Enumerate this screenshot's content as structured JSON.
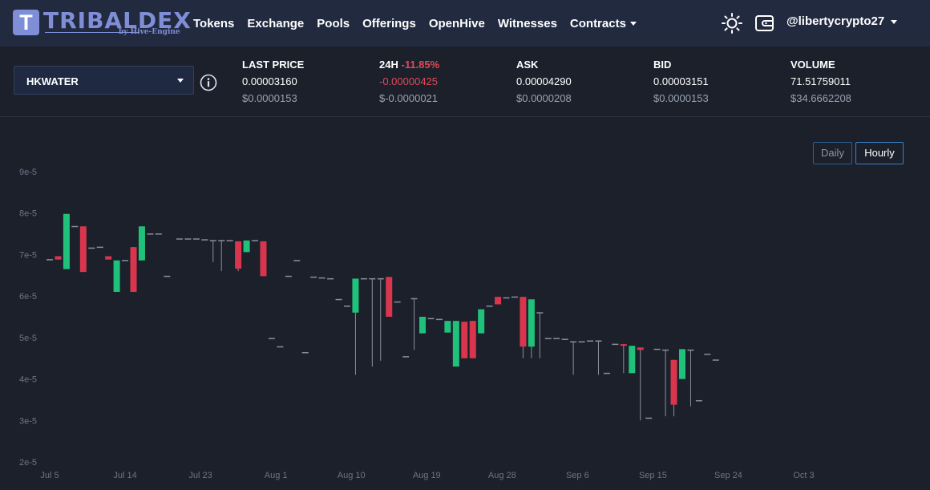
{
  "nav": {
    "logo_letter": "T",
    "logo_text": "TRIBALDEX",
    "logo_sub": "by Hive-Engine",
    "links": [
      {
        "label": "Tokens"
      },
      {
        "label": "Exchange"
      },
      {
        "label": "Pools"
      },
      {
        "label": "Offerings"
      },
      {
        "label": "OpenHive"
      },
      {
        "label": "Witnesses"
      },
      {
        "label": "Contracts",
        "dropdown": true
      }
    ],
    "theme_icon": "sun-icon",
    "wallet_icon": "wallet-icon",
    "username": "@libertycrypto27"
  },
  "token": {
    "selected": "HKWATER",
    "info_icon": "info-icon",
    "stats": {
      "last_price": {
        "title": "LAST PRICE",
        "value": "0.00003160",
        "usd": "$0.0000153"
      },
      "change_24h": {
        "title": "24H",
        "change_pct": "-11.85%",
        "value": "-0.00000425",
        "usd": "$-0.0000021"
      },
      "ask": {
        "title": "ASK",
        "value": "0.00004290",
        "usd": "$0.0000208"
      },
      "bid": {
        "title": "BID",
        "value": "0.00003151",
        "usd": "$0.0000153"
      },
      "volume": {
        "title": "VOLUME",
        "value": "71.51759011",
        "usd": "$34.6662208"
      }
    }
  },
  "chart_controls": {
    "daily": "Daily",
    "hourly": "Hourly",
    "active": "Hourly"
  },
  "colors": {
    "up": "#1fc17b",
    "down": "#d9364e",
    "flat": "#8a8f9c",
    "accent": "#7f8ed6",
    "negative_text": "#e04b58"
  },
  "chart_data": {
    "type": "candlestick",
    "y_ticks": [
      "9e-5",
      "8e-5",
      "7e-5",
      "6e-5",
      "5e-5",
      "4e-5",
      "3e-5",
      "2e-5"
    ],
    "ylim": [
      2e-05,
      9e-05
    ],
    "x_ticks": [
      "Jul 5",
      "Jul 14",
      "Jul 23",
      "Aug 1",
      "Aug 10",
      "Aug 19",
      "Aug 28",
      "Sep 6",
      "Sep 15",
      "Sep 24",
      "Oct 3"
    ],
    "x_tick_day_index": [
      0,
      9,
      18,
      27,
      36,
      45,
      54,
      63,
      72,
      81,
      90
    ],
    "candles": [
      {
        "d": 0.0,
        "o": 6.88,
        "h": 6.88,
        "l": 6.88,
        "c": 6.88
      },
      {
        "d": 1.0,
        "o": 6.96,
        "h": 6.96,
        "l": 6.88,
        "c": 6.88
      },
      {
        "d": 2.0,
        "o": 6.65,
        "h": 7.98,
        "l": 6.65,
        "c": 7.98
      },
      {
        "d": 3.0,
        "o": 7.68,
        "h": 7.68,
        "l": 7.68,
        "c": 7.68
      },
      {
        "d": 4.0,
        "o": 7.68,
        "h": 7.68,
        "l": 6.58,
        "c": 6.58
      },
      {
        "d": 5.0,
        "o": 7.16,
        "h": 7.16,
        "l": 7.16,
        "c": 7.16
      },
      {
        "d": 6.0,
        "o": 7.18,
        "h": 7.18,
        "l": 7.18,
        "c": 7.18
      },
      {
        "d": 7.0,
        "o": 6.96,
        "h": 6.96,
        "l": 6.88,
        "c": 6.88
      },
      {
        "d": 8.0,
        "o": 6.1,
        "h": 6.86,
        "l": 6.1,
        "c": 6.86
      },
      {
        "d": 9.0,
        "o": 6.86,
        "h": 6.86,
        "l": 6.86,
        "c": 6.86
      },
      {
        "d": 10.0,
        "o": 7.18,
        "h": 7.18,
        "l": 6.1,
        "c": 6.1
      },
      {
        "d": 11.0,
        "o": 6.86,
        "h": 7.68,
        "l": 6.86,
        "c": 7.68
      },
      {
        "d": 12.0,
        "o": 7.5,
        "h": 7.5,
        "l": 7.5,
        "c": 7.5
      },
      {
        "d": 13.0,
        "o": 7.5,
        "h": 7.5,
        "l": 7.5,
        "c": 7.5
      },
      {
        "d": 14.0,
        "o": 6.48,
        "h": 6.48,
        "l": 6.48,
        "c": 6.48
      },
      {
        "d": 15.5,
        "o": 7.38,
        "h": 7.38,
        "l": 7.38,
        "c": 7.38
      },
      {
        "d": 16.5,
        "o": 7.38,
        "h": 7.38,
        "l": 7.38,
        "c": 7.38
      },
      {
        "d": 17.5,
        "o": 7.38,
        "h": 7.38,
        "l": 7.38,
        "c": 7.38
      },
      {
        "d": 18.5,
        "o": 7.36,
        "h": 7.36,
        "l": 7.36,
        "c": 7.36
      },
      {
        "d": 19.5,
        "o": 7.34,
        "h": 7.34,
        "l": 6.82,
        "c": 7.34
      },
      {
        "d": 20.5,
        "o": 7.34,
        "h": 7.34,
        "l": 6.6,
        "c": 7.34
      },
      {
        "d": 21.5,
        "o": 7.34,
        "h": 7.34,
        "l": 7.34,
        "c": 7.34
      },
      {
        "d": 22.5,
        "o": 7.32,
        "h": 7.32,
        "l": 6.6,
        "c": 6.66
      },
      {
        "d": 23.5,
        "o": 7.06,
        "h": 7.34,
        "l": 7.06,
        "c": 7.34
      },
      {
        "d": 24.5,
        "o": 7.34,
        "h": 7.34,
        "l": 7.34,
        "c": 7.34
      },
      {
        "d": 25.5,
        "o": 7.32,
        "h": 7.32,
        "l": 6.48,
        "c": 6.48
      },
      {
        "d": 26.5,
        "o": 4.98,
        "h": 4.98,
        "l": 4.98,
        "c": 4.98
      },
      {
        "d": 27.5,
        "o": 4.78,
        "h": 4.78,
        "l": 4.78,
        "c": 4.78
      },
      {
        "d": 28.5,
        "o": 6.48,
        "h": 6.48,
        "l": 6.48,
        "c": 6.48
      },
      {
        "d": 29.5,
        "o": 6.86,
        "h": 6.86,
        "l": 6.86,
        "c": 6.86
      },
      {
        "d": 30.5,
        "o": 4.64,
        "h": 4.64,
        "l": 4.64,
        "c": 4.64
      },
      {
        "d": 31.5,
        "o": 6.46,
        "h": 6.46,
        "l": 6.46,
        "c": 6.46
      },
      {
        "d": 32.5,
        "o": 6.44,
        "h": 6.44,
        "l": 6.44,
        "c": 6.44
      },
      {
        "d": 33.5,
        "o": 6.42,
        "h": 6.42,
        "l": 6.42,
        "c": 6.42
      },
      {
        "d": 34.5,
        "o": 5.92,
        "h": 5.92,
        "l": 5.92,
        "c": 5.92
      },
      {
        "d": 35.5,
        "o": 5.76,
        "h": 5.76,
        "l": 5.76,
        "c": 5.76
      },
      {
        "d": 36.5,
        "o": 5.6,
        "h": 6.42,
        "l": 4.1,
        "c": 6.42
      },
      {
        "d": 37.5,
        "o": 6.42,
        "h": 6.42,
        "l": 6.42,
        "c": 6.42
      },
      {
        "d": 38.5,
        "o": 6.42,
        "h": 6.42,
        "l": 4.3,
        "c": 6.42
      },
      {
        "d": 39.5,
        "o": 6.42,
        "h": 6.42,
        "l": 4.44,
        "c": 6.42
      },
      {
        "d": 40.5,
        "o": 6.46,
        "h": 6.46,
        "l": 5.5,
        "c": 5.5
      },
      {
        "d": 41.5,
        "o": 5.86,
        "h": 5.86,
        "l": 5.86,
        "c": 5.86
      },
      {
        "d": 42.5,
        "o": 4.54,
        "h": 4.54,
        "l": 4.54,
        "c": 4.54
      },
      {
        "d": 43.5,
        "o": 5.94,
        "h": 5.94,
        "l": 4.7,
        "c": 5.94
      },
      {
        "d": 44.5,
        "o": 5.1,
        "h": 5.5,
        "l": 5.1,
        "c": 5.5
      },
      {
        "d": 45.5,
        "o": 5.46,
        "h": 5.46,
        "l": 5.46,
        "c": 5.46
      },
      {
        "d": 46.5,
        "o": 5.44,
        "h": 5.44,
        "l": 5.44,
        "c": 5.44
      },
      {
        "d": 47.5,
        "o": 5.12,
        "h": 5.4,
        "l": 5.12,
        "c": 5.4
      },
      {
        "d": 48.5,
        "o": 4.3,
        "h": 5.4,
        "l": 4.3,
        "c": 5.4
      },
      {
        "d": 49.5,
        "o": 5.38,
        "h": 5.38,
        "l": 4.5,
        "c": 4.5
      },
      {
        "d": 50.5,
        "o": 5.4,
        "h": 5.4,
        "l": 4.5,
        "c": 4.5
      },
      {
        "d": 51.5,
        "o": 5.1,
        "h": 5.68,
        "l": 5.1,
        "c": 5.68
      },
      {
        "d": 52.5,
        "o": 5.76,
        "h": 5.76,
        "l": 5.76,
        "c": 5.76
      },
      {
        "d": 53.5,
        "o": 5.98,
        "h": 5.98,
        "l": 5.8,
        "c": 5.8
      },
      {
        "d": 54.5,
        "o": 5.96,
        "h": 5.96,
        "l": 5.96,
        "c": 5.96
      },
      {
        "d": 55.5,
        "o": 5.98,
        "h": 5.98,
        "l": 5.98,
        "c": 5.98
      },
      {
        "d": 56.5,
        "o": 5.98,
        "h": 5.98,
        "l": 4.5,
        "c": 4.78
      },
      {
        "d": 57.5,
        "o": 4.78,
        "h": 5.92,
        "l": 4.5,
        "c": 5.92
      },
      {
        "d": 58.5,
        "o": 5.6,
        "h": 5.6,
        "l": 4.5,
        "c": 5.6
      },
      {
        "d": 59.5,
        "o": 4.98,
        "h": 4.98,
        "l": 4.98,
        "c": 4.98
      },
      {
        "d": 60.5,
        "o": 4.98,
        "h": 4.98,
        "l": 4.98,
        "c": 4.98
      },
      {
        "d": 61.5,
        "o": 4.96,
        "h": 4.96,
        "l": 4.96,
        "c": 4.96
      },
      {
        "d": 62.5,
        "o": 4.9,
        "h": 4.9,
        "l": 4.1,
        "c": 4.9
      },
      {
        "d": 63.5,
        "o": 4.9,
        "h": 4.9,
        "l": 4.9,
        "c": 4.9
      },
      {
        "d": 64.5,
        "o": 4.92,
        "h": 4.92,
        "l": 4.92,
        "c": 4.92
      },
      {
        "d": 65.5,
        "o": 4.92,
        "h": 4.92,
        "l": 4.1,
        "c": 4.92
      },
      {
        "d": 66.5,
        "o": 4.14,
        "h": 4.14,
        "l": 4.14,
        "c": 4.14
      },
      {
        "d": 67.5,
        "o": 4.84,
        "h": 4.84,
        "l": 4.84,
        "c": 4.84
      },
      {
        "d": 68.5,
        "o": 4.84,
        "h": 4.84,
        "l": 4.14,
        "c": 4.8
      },
      {
        "d": 69.5,
        "o": 4.14,
        "h": 4.8,
        "l": 4.14,
        "c": 4.8
      },
      {
        "d": 70.5,
        "o": 4.76,
        "h": 4.76,
        "l": 3.0,
        "c": 4.7
      },
      {
        "d": 71.5,
        "o": 3.06,
        "h": 3.06,
        "l": 3.06,
        "c": 3.06
      },
      {
        "d": 72.5,
        "o": 4.72,
        "h": 4.72,
        "l": 4.72,
        "c": 4.72
      },
      {
        "d": 73.5,
        "o": 4.7,
        "h": 4.7,
        "l": 3.1,
        "c": 4.7
      },
      {
        "d": 74.5,
        "o": 4.46,
        "h": 4.46,
        "l": 3.1,
        "c": 3.38
      },
      {
        "d": 75.5,
        "o": 4.0,
        "h": 4.72,
        "l": 4.0,
        "c": 4.72
      },
      {
        "d": 76.5,
        "o": 4.7,
        "h": 4.7,
        "l": 3.34,
        "c": 4.7
      },
      {
        "d": 77.5,
        "o": 3.48,
        "h": 3.48,
        "l": 3.48,
        "c": 3.48
      },
      {
        "d": 78.5,
        "o": 4.6,
        "h": 4.6,
        "l": 4.6,
        "c": 4.6
      },
      {
        "d": 79.5,
        "o": 4.46,
        "h": 4.46,
        "l": 4.46,
        "c": 4.46
      }
    ]
  }
}
